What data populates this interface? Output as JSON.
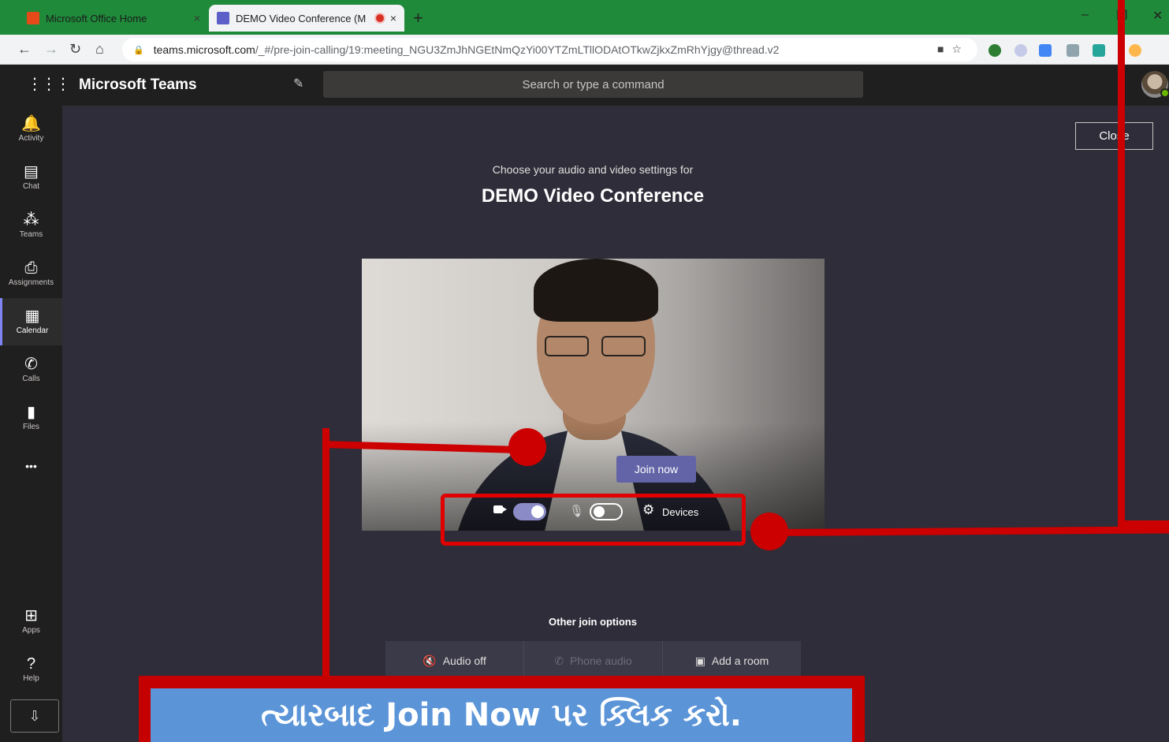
{
  "browser": {
    "tabs": [
      {
        "title": "Microsoft Office Home",
        "close": "×"
      },
      {
        "title": "DEMO Video Conference (M",
        "close": "×"
      }
    ],
    "new_tab": "+",
    "nav": {
      "back": "←",
      "forward": "→",
      "reload": "↻",
      "home": "⌂"
    },
    "url_host": "teams.microsoft.com",
    "url_path": "/_#/pre-join-calling/19:meeting_NGU3ZmJhNGEtNmQzYi00YTZmLTllODAtOTkwZjkxZmRhYjgy@thread.v2",
    "window_controls": {
      "minimize": "–",
      "restore": "❐",
      "close": "✕"
    }
  },
  "teams": {
    "brand": "Microsoft Teams",
    "search_placeholder": "Search or type a command"
  },
  "rail": {
    "items": [
      {
        "label": "Activity",
        "icon": "bell-icon",
        "glyph": "🔔"
      },
      {
        "label": "Chat",
        "icon": "chat-icon",
        "glyph": "▤"
      },
      {
        "label": "Teams",
        "icon": "teams-icon",
        "glyph": "⁂"
      },
      {
        "label": "Assignments",
        "icon": "assignments-icon",
        "glyph": "⎙"
      },
      {
        "label": "Calendar",
        "icon": "calendar-icon",
        "glyph": "▦"
      },
      {
        "label": "Calls",
        "icon": "phone-icon",
        "glyph": "✆"
      },
      {
        "label": "Files",
        "icon": "files-icon",
        "glyph": "▮"
      }
    ],
    "more": "•••",
    "apps": "Apps",
    "help": "Help",
    "active": "Calendar"
  },
  "prejoin": {
    "close_label": "Close",
    "subtitle": "Choose your audio and video settings for",
    "meeting_title": "DEMO Video Conference",
    "join_label": "Join now",
    "video_on": true,
    "mic_on": false,
    "devices_label": "Devices",
    "other_options_heading": "Other join options",
    "other_options": [
      {
        "label": "Audio off",
        "icon": "speaker-off-icon",
        "glyph": "🔇",
        "enabled": true
      },
      {
        "label": "Phone audio",
        "icon": "phone-icon",
        "glyph": "✆",
        "enabled": false
      },
      {
        "label": "Add a room",
        "icon": "cast-icon",
        "glyph": "▣",
        "enabled": true
      }
    ]
  },
  "annotation": {
    "caption": "ત્યારબાદ Join Now પર ક્લિક કરો.",
    "color": "#cc0000",
    "banner_color": "#5b95d8"
  },
  "colors": {
    "teams_purple": "#6264a7",
    "tab_strip": "#1f8a3a",
    "main_bg": "#2e2d39",
    "rail_bg": "#201f1f"
  }
}
